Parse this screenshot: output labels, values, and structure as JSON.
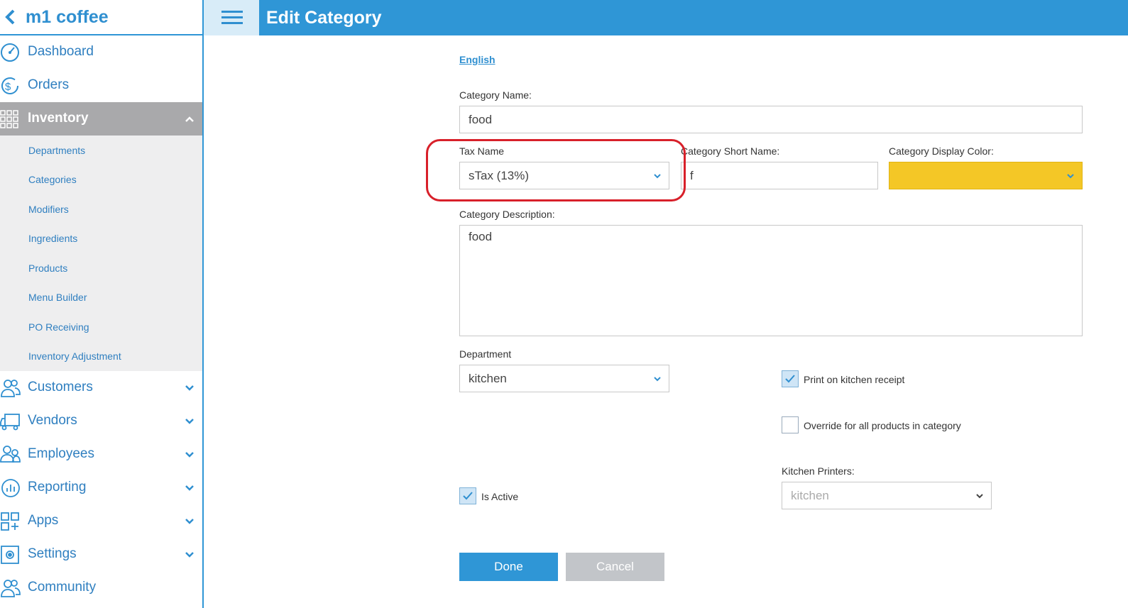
{
  "app": {
    "name": "m1 coffee"
  },
  "header": {
    "title": "Edit Category"
  },
  "sidebar": {
    "items": [
      {
        "label": "Dashboard",
        "icon": "dashboard-icon"
      },
      {
        "label": "Orders",
        "icon": "dollar-icon"
      },
      {
        "label": "Inventory",
        "icon": "grid-icon",
        "active": true
      },
      {
        "label": "Customers",
        "icon": "users-icon"
      },
      {
        "label": "Vendors",
        "icon": "truck-icon"
      },
      {
        "label": "Employees",
        "icon": "employees-icon"
      },
      {
        "label": "Reporting",
        "icon": "chart-icon"
      },
      {
        "label": "Apps",
        "icon": "apps-icon"
      },
      {
        "label": "Settings",
        "icon": "gear-icon"
      },
      {
        "label": "Community",
        "icon": "community-icon"
      }
    ],
    "inventory_sub": [
      "Departments",
      "Categories",
      "Modifiers",
      "Ingredients",
      "Products",
      "Menu Builder",
      "PO Receiving",
      "Inventory Adjustment"
    ]
  },
  "form": {
    "language": "English",
    "category_name_label": "Category Name:",
    "category_name_value": "food",
    "tax_name_label": "Tax Name",
    "tax_name_value": "sTax (13%)",
    "short_name_label": "Category Short Name:",
    "short_name_value": "f",
    "display_color_label": "Category Display Color:",
    "display_color": "#f4c726",
    "description_label": "Category Description:",
    "description_value": "food",
    "department_label": "Department",
    "department_value": "kitchen",
    "print_kitchen_label": "Print on kitchen receipt",
    "print_kitchen_checked": true,
    "override_label": "Override for all products in category",
    "override_checked": false,
    "kitchen_printers_label": "Kitchen Printers:",
    "kitchen_printers_placeholder": "kitchen",
    "is_active_label": "Is Active",
    "is_active_checked": true,
    "done_label": "Done",
    "cancel_label": "Cancel"
  },
  "colors": {
    "accent": "#2f96d6",
    "highlight": "#d8202a",
    "active_nav": "#a9a9ab"
  }
}
